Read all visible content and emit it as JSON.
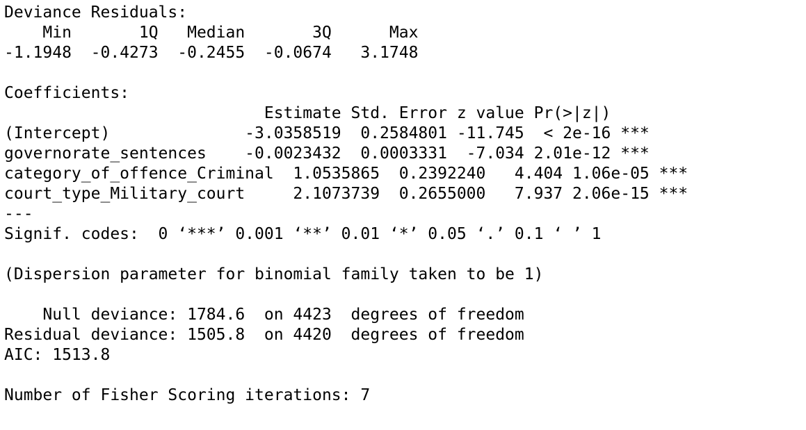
{
  "console": {
    "lines": [
      "Deviance Residuals: ",
      "    Min       1Q   Median       3Q      Max  ",
      "-1.1948  -0.4273  -0.2455  -0.0674   3.1748  ",
      "",
      "Coefficients:",
      "                           Estimate Std. Error z value Pr(>|z|)    ",
      "(Intercept)              -3.0358519  0.2584801 -11.745  < 2e-16 ***",
      "governorate_sentences    -0.0023432  0.0003331  -7.034 2.01e-12 ***",
      "category_of_offence_Criminal  1.0535865  0.2392240   4.404 1.06e-05 ***",
      "court_type_Military_court     2.1073739  0.2655000   7.937 2.06e-15 ***",
      "---",
      "Signif. codes:  0 ‘***’ 0.001 ‘**’ 0.01 ‘*’ 0.05 ‘.’ 0.1 ‘ ’ 1",
      "",
      "(Dispersion parameter for binomial family taken to be 1)",
      "",
      "    Null deviance: 1784.6  on 4423  degrees of freedom",
      "Residual deviance: 1505.8  on 4420  degrees of freedom",
      "AIC: 1513.8",
      "",
      "Number of Fisher Scoring iterations: 7"
    ]
  }
}
